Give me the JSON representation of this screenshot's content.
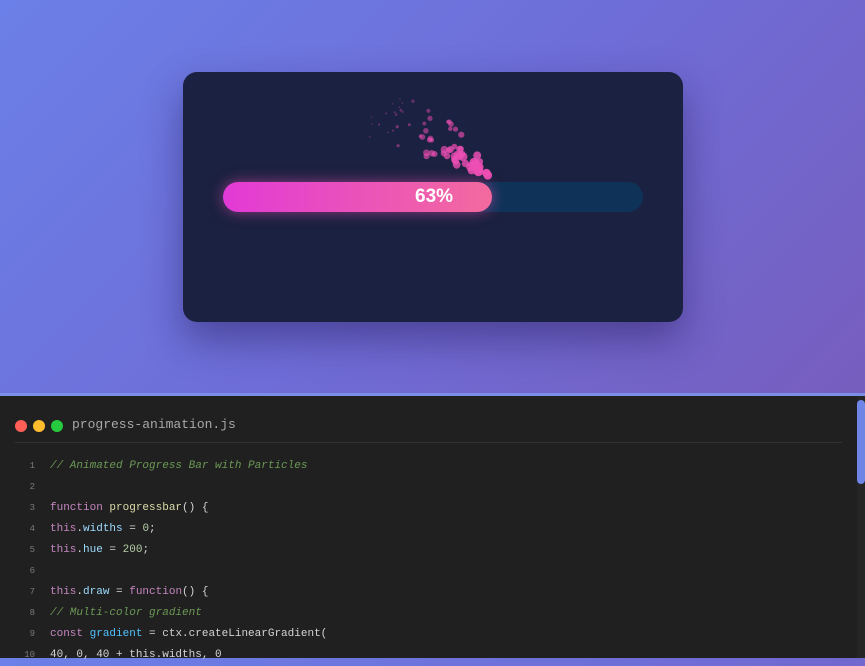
{
  "progress": {
    "value": 0.63,
    "label": "63%",
    "fill_gradient": [
      "#e23ad6",
      "#f36a9e"
    ],
    "track_color": "#0f3358",
    "card_color": "#1b2140",
    "particle_color": "#ee4fb4"
  },
  "editor": {
    "filename": "progress-animation.js",
    "window_controls": [
      "close",
      "minimize",
      "maximize"
    ],
    "lines": [
      {
        "num": "1",
        "tokens": [
          {
            "t": "// Animated Progress Bar with Particles",
            "c": "comment"
          }
        ]
      },
      {
        "num": "2",
        "tokens": []
      },
      {
        "num": "3",
        "tokens": [
          {
            "t": "function",
            "c": "kw"
          },
          {
            "t": " ",
            "c": ""
          },
          {
            "t": "progressbar",
            "c": "fn"
          },
          {
            "t": "() {",
            "c": ""
          }
        ]
      },
      {
        "num": "4",
        "tokens": [
          {
            "t": "this",
            "c": "kw"
          },
          {
            "t": ".",
            "c": ""
          },
          {
            "t": "widths",
            "c": "prop"
          },
          {
            "t": " = ",
            "c": ""
          },
          {
            "t": "0",
            "c": "num"
          },
          {
            "t": ";",
            "c": ""
          }
        ]
      },
      {
        "num": "5",
        "tokens": [
          {
            "t": "this",
            "c": "kw"
          },
          {
            "t": ".",
            "c": ""
          },
          {
            "t": "hue",
            "c": "prop"
          },
          {
            "t": " = ",
            "c": ""
          },
          {
            "t": "200",
            "c": "num"
          },
          {
            "t": ";",
            "c": ""
          }
        ]
      },
      {
        "num": "6",
        "tokens": []
      },
      {
        "num": "7",
        "tokens": [
          {
            "t": "this",
            "c": "kw"
          },
          {
            "t": ".",
            "c": ""
          },
          {
            "t": "draw",
            "c": "prop"
          },
          {
            "t": " = ",
            "c": ""
          },
          {
            "t": "function",
            "c": "kw"
          },
          {
            "t": "() {",
            "c": ""
          }
        ]
      },
      {
        "num": "8",
        "tokens": [
          {
            "t": "// Multi-color gradient",
            "c": "comment"
          }
        ]
      },
      {
        "num": "9",
        "tokens": [
          {
            "t": "const",
            "c": "kw"
          },
          {
            "t": " ",
            "c": ""
          },
          {
            "t": "gradient",
            "c": "var"
          },
          {
            "t": " = ctx.createLinearGradient(",
            "c": ""
          }
        ]
      },
      {
        "num": "10",
        "tokens": [
          {
            "t": "40, 0, 40 + this.widths, 0",
            "c": ""
          }
        ]
      }
    ]
  }
}
